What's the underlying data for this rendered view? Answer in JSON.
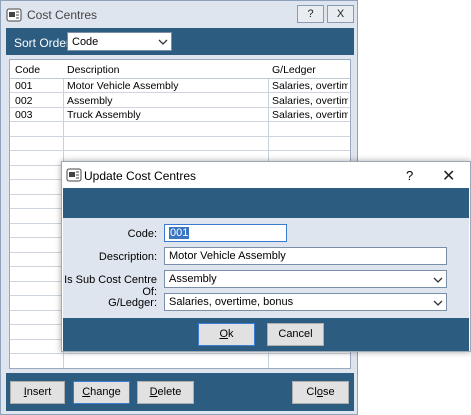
{
  "window": {
    "title": "Cost Centres",
    "help_label": "?",
    "close_label": "X"
  },
  "sort": {
    "label": "Sort Order",
    "value": "Code"
  },
  "table": {
    "headers": [
      "Code",
      "Description",
      "G/Ledger"
    ],
    "rows": [
      [
        "001",
        "Motor Vehicle Assembly",
        "Salaries, overtim..."
      ],
      [
        "002",
        "Assembly",
        "Salaries, overtim..."
      ],
      [
        "003",
        "Truck Assembly",
        "Salaries, overtim..."
      ]
    ]
  },
  "buttons": {
    "insert": {
      "pre": "",
      "key": "I",
      "post": "nsert"
    },
    "change": {
      "pre": "",
      "key": "C",
      "post": "hange"
    },
    "delete": {
      "pre": "",
      "key": "D",
      "post": "elete"
    },
    "close": {
      "pre": "Cl",
      "key": "o",
      "post": "se"
    }
  },
  "dialog": {
    "title": "Update Cost Centres",
    "help_label": "?",
    "close_label": "✕",
    "code_label": "Code:",
    "code_value": "001",
    "description_label": "Description:",
    "description_value": "Motor Vehicle Assembly",
    "subcentre_label": "Is Sub Cost Centre Of:",
    "subcentre_value": "Assembly",
    "gledger_label": "G/Ledger:",
    "gledger_value": "Salaries, overtime, bonus",
    "ok": {
      "pre": "",
      "key": "O",
      "post": "k"
    },
    "cancel_label": "Cancel"
  },
  "colors": {
    "accent": "#2c5d80",
    "panel": "#dfe5ee",
    "selection": "#3a75c4"
  }
}
